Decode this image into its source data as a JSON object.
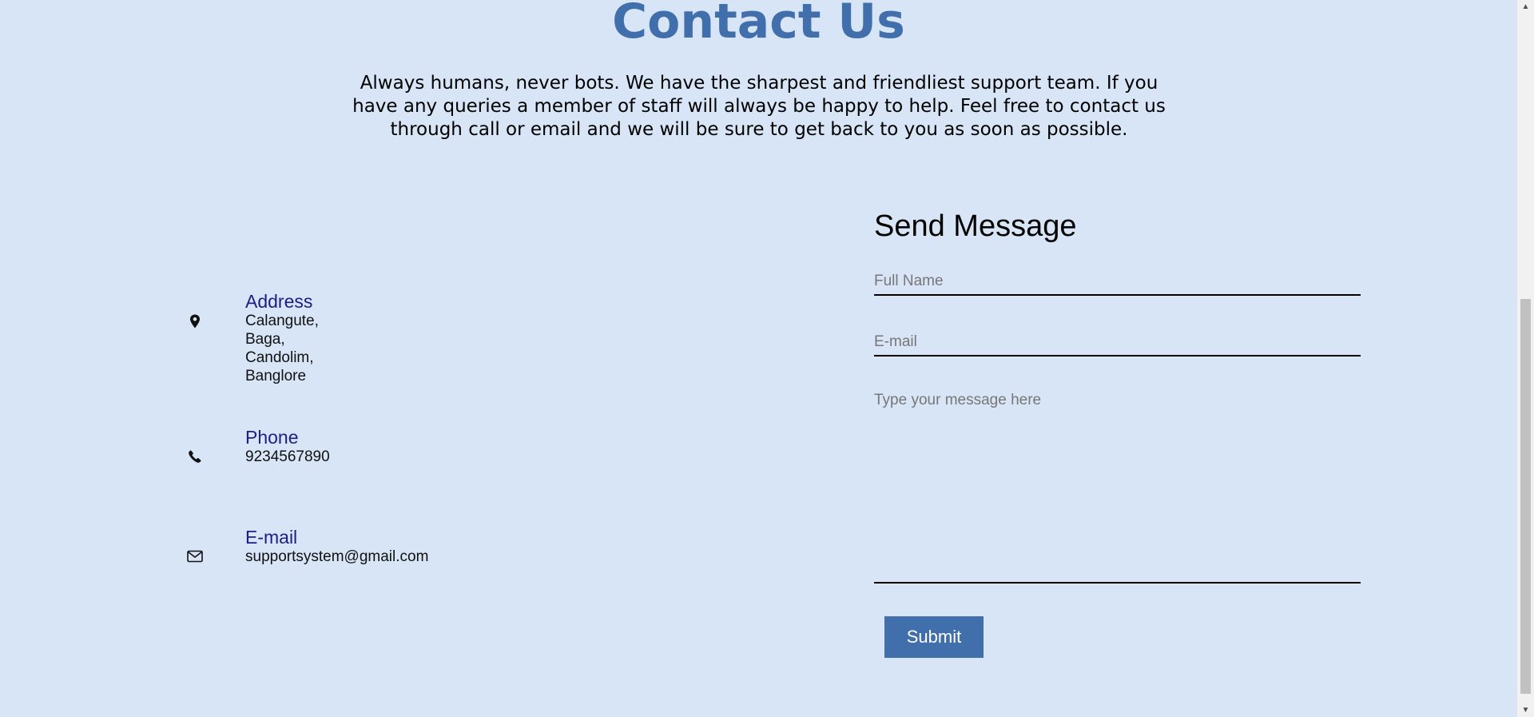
{
  "header": {
    "title": "Contact Us",
    "intro": "Always humans, never bots. We have the sharpest and friendliest support team. If you have any queries a member of staff will always be happy to help. Feel free to contact us through call or email and we will be sure to get back to you as soon as possible."
  },
  "contact_info": {
    "address": {
      "icon": "map-pin-icon",
      "heading": "Address",
      "lines": [
        "Calangute,",
        "Baga,",
        "Candolim,",
        "Banglore"
      ]
    },
    "phone": {
      "icon": "phone-icon",
      "heading": "Phone",
      "value": "9234567890"
    },
    "email": {
      "icon": "envelope-icon",
      "heading": "E-mail",
      "value": "supportsystem@gmail.com"
    }
  },
  "form": {
    "title": "Send Message",
    "full_name": {
      "placeholder": "Full Name",
      "value": ""
    },
    "email": {
      "placeholder": "E-mail",
      "value": ""
    },
    "message": {
      "placeholder": "Type your message here",
      "value": ""
    },
    "submit_label": "Submit"
  },
  "colors": {
    "background": "#d7e5f6",
    "accent": "#416fab",
    "heading_blue": "#1c1e84"
  }
}
